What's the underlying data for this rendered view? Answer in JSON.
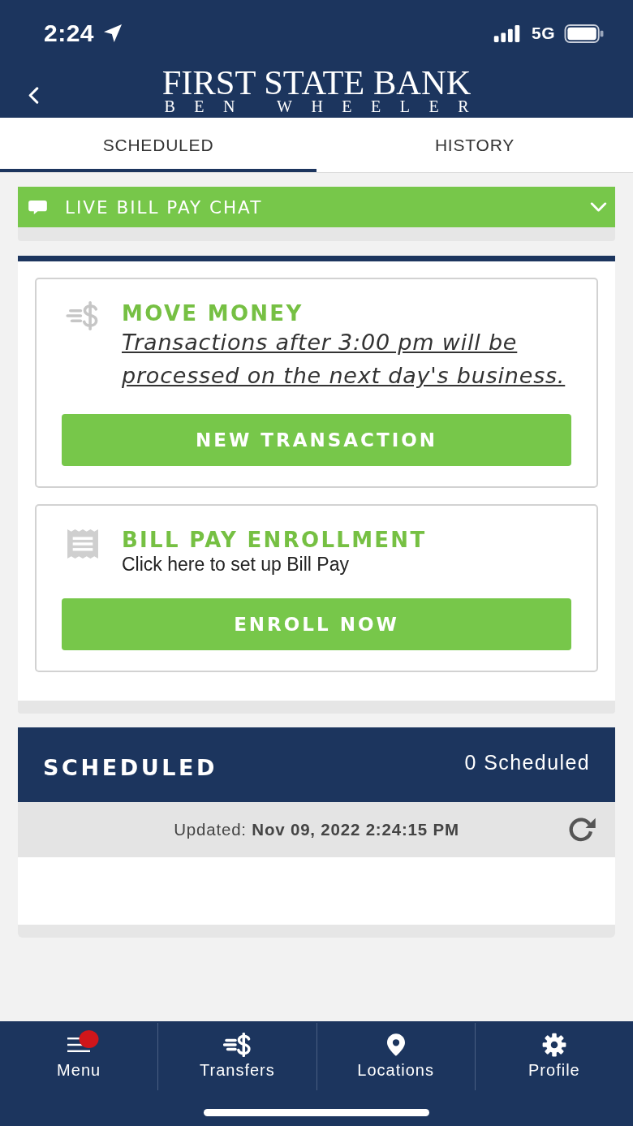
{
  "status_bar": {
    "time": "2:24",
    "network": "5G"
  },
  "header": {
    "logo_title": "FIRST STATE BANK",
    "logo_subtitle": "BEN WHEELER"
  },
  "tabs": [
    {
      "label": "SCHEDULED",
      "selected": true
    },
    {
      "label": "HISTORY",
      "selected": false
    }
  ],
  "chat_bar": {
    "label": "LIVE BILL PAY CHAT",
    "expanded": false
  },
  "cards": [
    {
      "kind": "transfer",
      "title": "MOVE MONEY",
      "note": "Transactions after 3:00 pm will be processed on the next day's business.",
      "button": "NEW TRANSACTION"
    },
    {
      "kind": "enrollment",
      "title": "BILL PAY ENROLLMENT",
      "note": "Click here to set up Bill Pay",
      "button": "ENROLL NOW"
    }
  ],
  "scheduled": {
    "title": "SCHEDULED",
    "count": "0 Scheduled",
    "updated": "Updated: **Nov 09, 2022 2:24:15 PM**"
  },
  "bottom_nav": [
    {
      "kind": "menu",
      "label": "Menu",
      "badge": true
    },
    {
      "kind": "transfers",
      "label": "Transfers",
      "badge": false
    },
    {
      "kind": "locations",
      "label": "Locations",
      "badge": false
    },
    {
      "kind": "profile",
      "label": "Profile",
      "badge": false
    }
  ]
}
